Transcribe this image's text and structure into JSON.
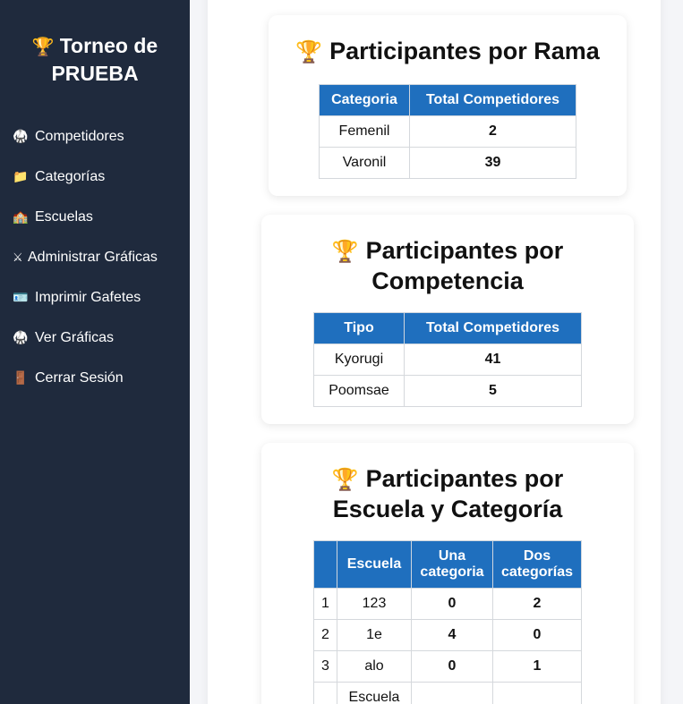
{
  "sidebar": {
    "brand_line1": "Torneo de",
    "brand_line2": "PRUEBA",
    "items": [
      {
        "icon": "🥋",
        "label": "Competidores"
      },
      {
        "icon": "📁",
        "label": "Categorías"
      },
      {
        "icon": "🏫",
        "label": "Escuelas"
      },
      {
        "icon": "⚔",
        "label": "Administrar Gráficas"
      },
      {
        "icon": "🪪",
        "label": "Imprimir Gafetes"
      },
      {
        "icon": "🥋",
        "label": "Ver Gráficas"
      },
      {
        "icon": "🚪",
        "label": "Cerrar Sesión"
      }
    ]
  },
  "rama": {
    "title": "Participantes por Rama",
    "headers": [
      "Categoria",
      "Total Competidores"
    ],
    "rows": [
      [
        "Femenil",
        "2"
      ],
      [
        "Varonil",
        "39"
      ]
    ]
  },
  "competencia": {
    "title_line1": "Participantes por",
    "title_line2": "Competencia",
    "headers": [
      "Tipo",
      "Total Competidores"
    ],
    "rows": [
      [
        "Kyorugi",
        "41"
      ],
      [
        "Poomsae",
        "5"
      ]
    ]
  },
  "escuela": {
    "title_line1": "Participantes por",
    "title_line2": "Escuela y Categoría",
    "headers": [
      "",
      "Escuela",
      "Una categoria",
      "Dos categorías"
    ],
    "rows": [
      [
        "1",
        "123",
        "0",
        "2"
      ],
      [
        "2",
        "1e",
        "4",
        "0"
      ],
      [
        "3",
        "alo",
        "0",
        "1"
      ],
      [
        "",
        "Escuela",
        "",
        ""
      ]
    ]
  },
  "colors": {
    "sidebar": "#1f2a3d",
    "table_header": "#1f6fbe"
  }
}
